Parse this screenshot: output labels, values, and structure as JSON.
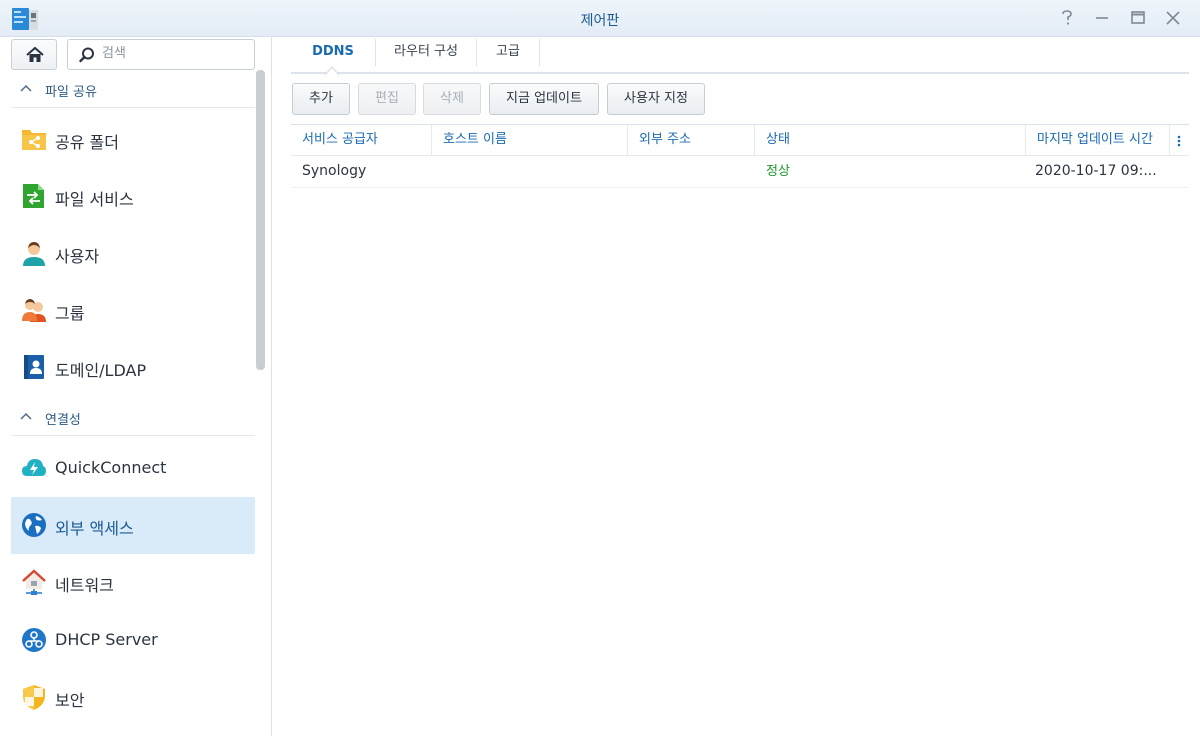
{
  "window": {
    "title": "제어판",
    "icons": {
      "app": "control-panel-icon",
      "help": "help-icon",
      "minimize": "minimize-icon",
      "maximize": "maximize-icon",
      "close": "close-icon"
    }
  },
  "sidebar": {
    "search_placeholder": "검색",
    "sections": [
      {
        "label": "파일 공유"
      },
      {
        "label": "연결성"
      }
    ],
    "items": [
      {
        "label": "공유 폴더",
        "icon": "shared-folder-icon"
      },
      {
        "label": "파일 서비스",
        "icon": "file-services-icon"
      },
      {
        "label": "사용자",
        "icon": "user-icon"
      },
      {
        "label": "그룹",
        "icon": "group-icon"
      },
      {
        "label": "도메인/LDAP",
        "icon": "domain-ldap-icon"
      },
      {
        "label": "QuickConnect",
        "icon": "quickconnect-icon"
      },
      {
        "label": "외부 액세스",
        "icon": "external-access-icon",
        "active": true
      },
      {
        "label": "네트워크",
        "icon": "network-icon"
      },
      {
        "label": "DHCP Server",
        "icon": "dhcp-server-icon"
      },
      {
        "label": "보안",
        "icon": "security-icon"
      }
    ]
  },
  "tabs": [
    {
      "label": "DDNS",
      "active": true
    },
    {
      "label": "라우터 구성"
    },
    {
      "label": "고급"
    }
  ],
  "toolbar": {
    "add": "추가",
    "edit": "편집",
    "delete": "삭제",
    "update_now": "지금 업데이트",
    "customize": "사용자 지정"
  },
  "table": {
    "columns": [
      "서비스 공급자",
      "호스트 이름",
      "외부 주소",
      "상태",
      "마지막 업데이트 시간"
    ],
    "rows": [
      {
        "provider": "Synology",
        "hostname": "",
        "external_address": "",
        "status": "정상",
        "last_update": "2020-10-17 09:..."
      }
    ]
  },
  "colors": {
    "accent": "#1a6ab2",
    "status_ok": "#1d9a2f",
    "active_bg": "#d9eaf9"
  }
}
